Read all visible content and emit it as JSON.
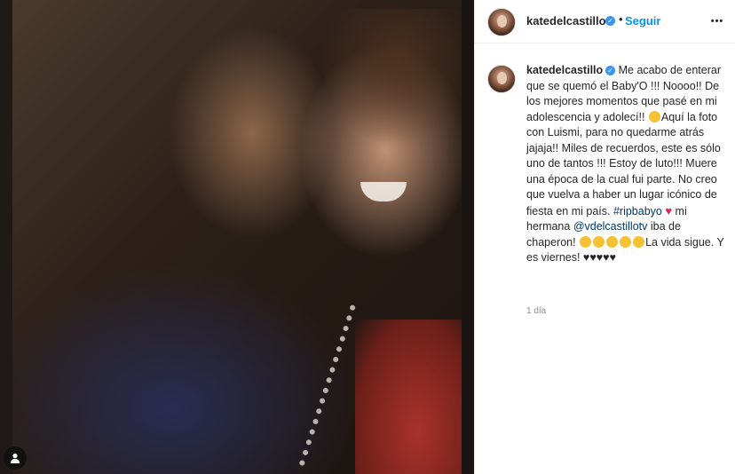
{
  "header": {
    "username": "katedelcastillo",
    "separator": "•",
    "follow_label": "Seguir",
    "more_label": "•••"
  },
  "caption": {
    "username": "katedelcastillo",
    "text_1": "Me acabo de enterar que se quemó el Baby'O !!! Noooo!! De los mejores momentos que pasé en mi adolescencia y adolecí!! ",
    "text_2": "Aquí la foto con Luismi, para no quedarme atrás jajaja!! Miles de recuerdos, este es sólo uno de tantos !!! Estoy de luto!!! Muere una época de la cual fui parte. No creo que vuelva a haber un lugar icónico de fiesta en mi país. ",
    "hashtag": "#ripbabyo",
    "heart": "♥",
    "text_3": " mi hermana ",
    "mention": "@vdelcastillotv",
    "text_4": " iba de chaperon! ",
    "text_5": "La vida sigue. Y es viernes! ♥♥♥♥♥"
  },
  "timestamp": "1 día",
  "icons": {
    "verified": "verified-badge-icon",
    "more": "more-options-icon",
    "tag": "user-tag-icon",
    "emoji": "laughing-emoji-icon"
  },
  "colors": {
    "follow": "#0095f6",
    "verified": "#3897f0",
    "link": "#00376b",
    "heart": "#e0245e"
  }
}
